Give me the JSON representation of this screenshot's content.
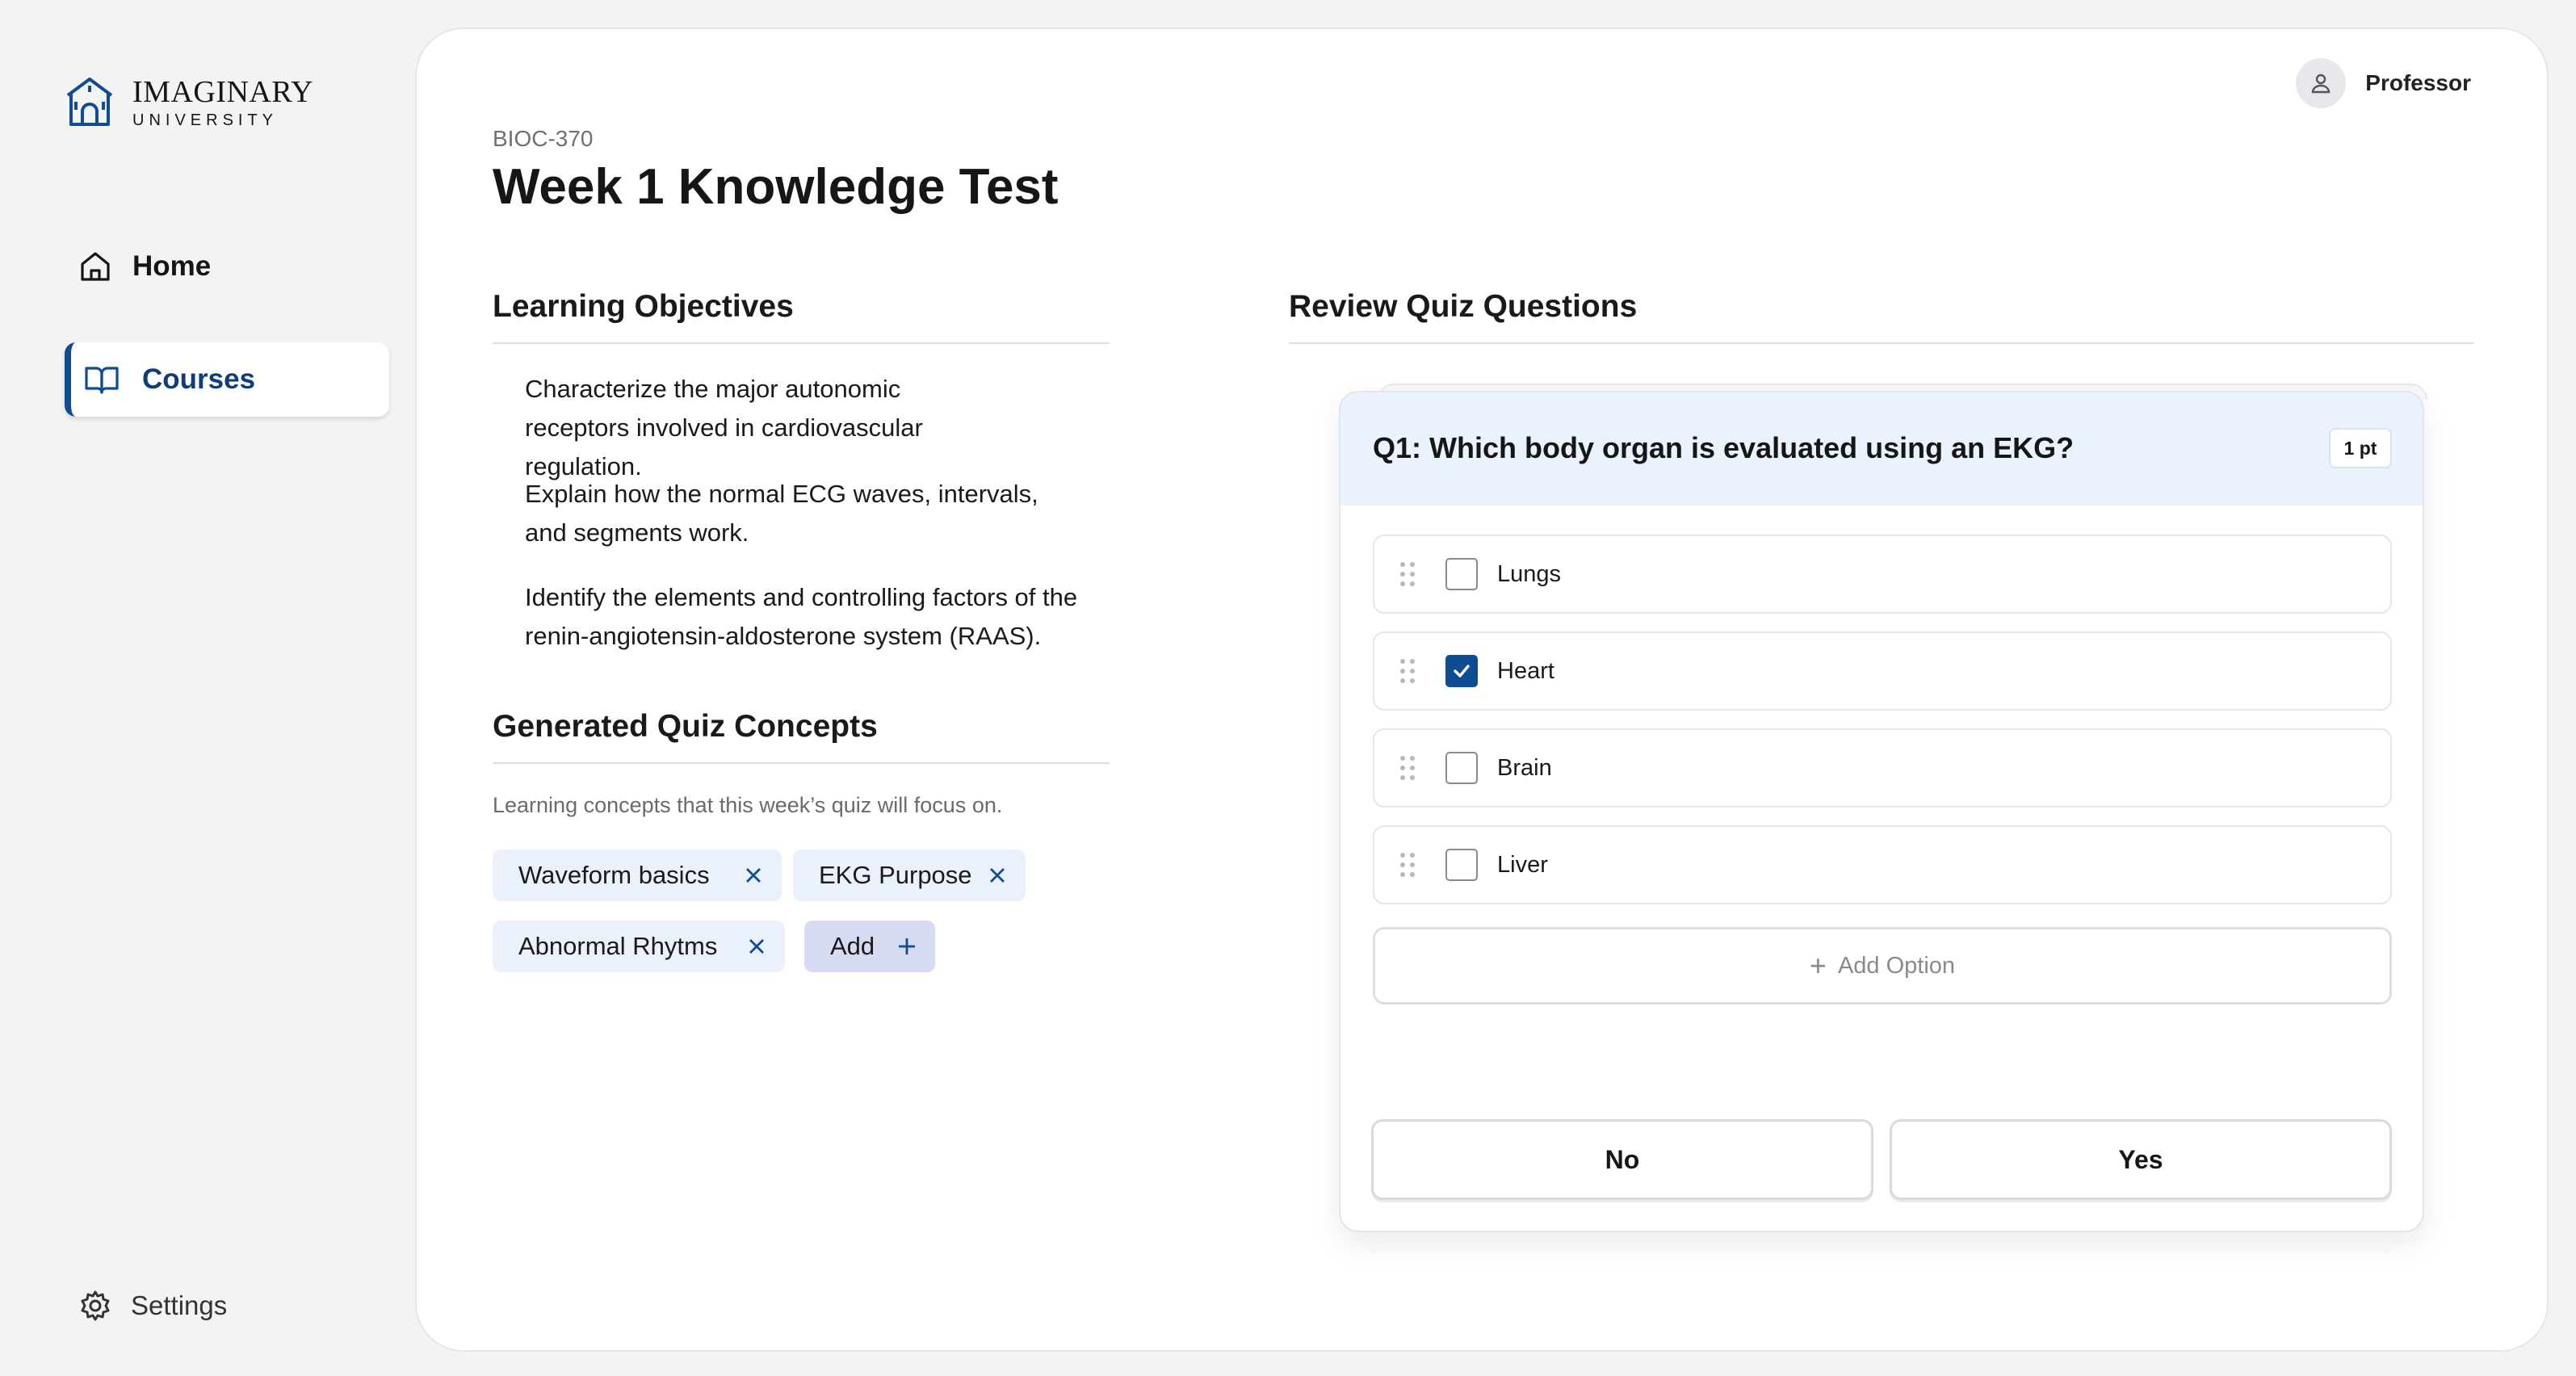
{
  "brand": {
    "title": "IMAGINARY",
    "subtitle": "UNIVERSITY"
  },
  "sidebar": {
    "items": [
      {
        "label": "Home",
        "icon": "home-icon"
      },
      {
        "label": "Courses",
        "icon": "book-icon",
        "active": true
      }
    ],
    "settings": {
      "label": "Settings",
      "icon": "gear-icon"
    }
  },
  "header": {
    "user": "Professor",
    "avatar_icon": "user-icon"
  },
  "page": {
    "course_code": "BIOC-370",
    "title": "Week 1 Knowledge Test"
  },
  "objectives": {
    "title": "Learning Objectives",
    "items": [
      "Characterize the major autonomic receptors involved in cardiovascular regulation.",
      "Explain how the normal ECG waves, intervals, and segments work.",
      "Identify the elements and controlling factors of the renin-angiotensin-aldosterone system (RAAS)."
    ]
  },
  "concepts": {
    "title": "Generated Quiz Concepts",
    "subtitle": "Learning concepts that this week’s quiz will focus on.",
    "chips": [
      "Waveform basics",
      "EKG Purpose",
      "Abnormal Rhytms"
    ],
    "add_label": "Add"
  },
  "review": {
    "title": "Review Quiz Questions",
    "question": "Q1: Which body organ is evaluated using an EKG?",
    "points": "1 pt",
    "options": [
      {
        "label": "Lungs",
        "checked": false
      },
      {
        "label": "Heart",
        "checked": true
      },
      {
        "label": "Brain",
        "checked": false
      },
      {
        "label": "Liver",
        "checked": false
      }
    ],
    "add_option_label": "Add Option",
    "no_label": "No",
    "yes_label": "Yes"
  },
  "colors": {
    "accent": "#0f4c92",
    "chip_bg": "#eaf1fb",
    "add_chip_bg": "#d7dbf1",
    "question_header_bg": "#eaf2fd"
  }
}
